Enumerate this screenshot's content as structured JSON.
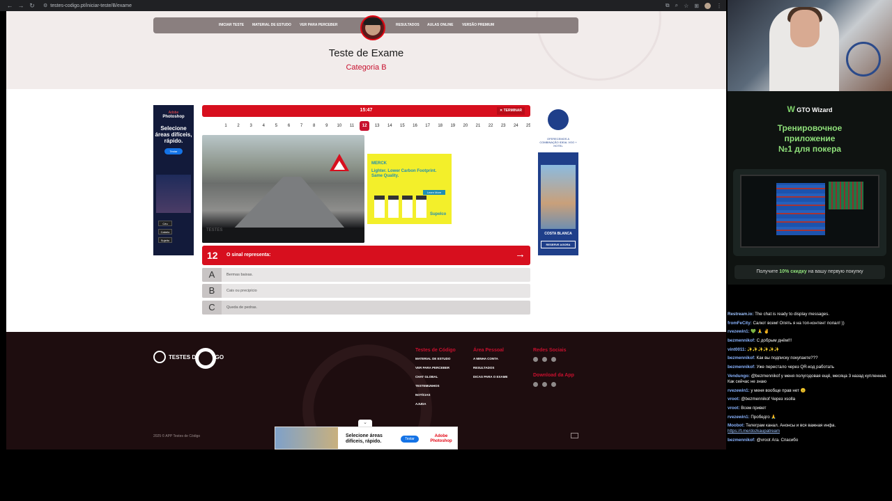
{
  "browser": {
    "url": "testes-codigo.pt/iniciar-teste/B/exame",
    "back_icon": "arrow-left-icon",
    "forward_icon": "arrow-right-icon",
    "reload_icon": "reload-icon"
  },
  "nav": {
    "items_left": [
      "INICIAR TESTE",
      "MATERIAL DE ESTUDO",
      "VER PARA PERCEBER"
    ],
    "items_right": [
      "RESULTADOS",
      "AULAS ONLINE",
      "VERSÃO PREMIUM"
    ]
  },
  "hero": {
    "title": "Teste de Exame",
    "subtitle": "Categoria B"
  },
  "exam": {
    "timer": "15:47",
    "end_label": "✕ TERMINAR",
    "question_numbers": [
      "1",
      "2",
      "3",
      "4",
      "5",
      "6",
      "7",
      "8",
      "9",
      "10",
      "11",
      "12",
      "13",
      "14",
      "15",
      "16",
      "17",
      "18",
      "19",
      "20",
      "21",
      "22",
      "23",
      "24",
      "25"
    ],
    "active_question": "12",
    "question_number": "12",
    "question_text": "O sinal representa:",
    "image_watermark": "TESTES",
    "answers": [
      {
        "letter": "A",
        "text": "Bermas baixas."
      },
      {
        "letter": "B",
        "text": "Cais ou precipício"
      },
      {
        "letter": "C",
        "text": "Queda de pedras."
      }
    ]
  },
  "ads": {
    "left": {
      "brand": "Adobe",
      "product": "Photoshop",
      "headline": "Selecione áreas difíceis, rápido.",
      "button": "Testar",
      "chips": [
        "Céu",
        "Cabelo",
        "Sujeito"
      ]
    },
    "middle": {
      "brand": "MERCK",
      "headline": "Lighter. Lower Carbon Footprint. Same Quality.",
      "button": "Learn More",
      "product": "Supelco"
    },
    "right": {
      "brand_text": "OFERECEMOS A COMBINAÇÃO IDEAL VOO + HOTEL",
      "location": "COSTA BLANCA",
      "button": "RESERVE AGORA"
    },
    "bottom": {
      "headline": "Selecione áreas difíceis, rápido.",
      "button": "Testar",
      "brand": "Adobe Photoshop"
    }
  },
  "footer": {
    "logo_text": "TESTES DE CÓDIGO",
    "col1": {
      "heading": "Testes de Código",
      "links": [
        "MATERIAL DE ESTUDO",
        "VER PARA PERCEBER",
        "CHAT GLOBAL",
        "TESTEMUNHOS",
        "NOTÍCIAS",
        "AJUDA"
      ]
    },
    "col2": {
      "heading": "Área Pessoal",
      "links": [
        "A MINHA CONTA",
        "RESULTADOS",
        "DICAS PARA O EXAME"
      ]
    },
    "col3": {
      "heading": "Redes Sociais",
      "heading2": "Download da App"
    },
    "copyright": "2025 © APP Testes de Código"
  },
  "stream": {
    "promo": {
      "brand": "GTO Wizard",
      "title_line1": "Тренировочное",
      "title_line2": "приложение",
      "title_line3": "№1 для покера",
      "discount_prefix": "Получите ",
      "discount_bold": "10% скидку",
      "discount_suffix": " на вашу первую покупку"
    },
    "chat": [
      {
        "user": "Restream.io:",
        "color": "#9fc4ff",
        "text": " The chat is ready to display messages."
      },
      {
        "user": "fromFeCity:",
        "color": "#8ab4ff",
        "text": " Салют всем! Опять я на топ-контент попал! ))"
      },
      {
        "user": "rvezewin1:",
        "color": "#8ab4ff",
        "text": " 💚 🙏 ✌"
      },
      {
        "user": "bezmennikof:",
        "color": "#8ab4ff",
        "text": " С добрым днём!!!"
      },
      {
        "user": "vint0011:",
        "color": "#8ab4ff",
        "text": " ✨✨✨✨✨✨"
      },
      {
        "user": "bezmennikof:",
        "color": "#8ab4ff",
        "text": " Как вы подписку покупаете???"
      },
      {
        "user": "bezmennikof:",
        "color": "#8ab4ff",
        "text": " Уже перестало через QR-код работать"
      },
      {
        "user": "Vendungo:",
        "color": "#8ab4ff",
        "text": " @bezmennikof у меня полугодовая ещё, месяца 3 назад купленная. Как сейчас не знаю"
      },
      {
        "user": "rvezewin1:",
        "color": "#8ab4ff",
        "text": " у меня вообще прав нет 😐"
      },
      {
        "user": "vroot:",
        "color": "#8ab4ff",
        "text": " @bezmennikof Через xsolla"
      },
      {
        "user": "vroot:",
        "color": "#8ab4ff",
        "text": " Всем привет"
      },
      {
        "user": "rvezewin1:",
        "color": "#8ab4ff",
        "text": " Пробедго 🙏"
      },
      {
        "user": "Moobot:",
        "color": "#8ab4ff",
        "text": " Телеграм канал. Анонсы и вся важная инфа.",
        "link": "https://t.me/dozkaupatream"
      },
      {
        "user": "bezmennikof:",
        "color": "#8ab4ff",
        "text": " @vroot Ага. Спасибо"
      }
    ]
  }
}
